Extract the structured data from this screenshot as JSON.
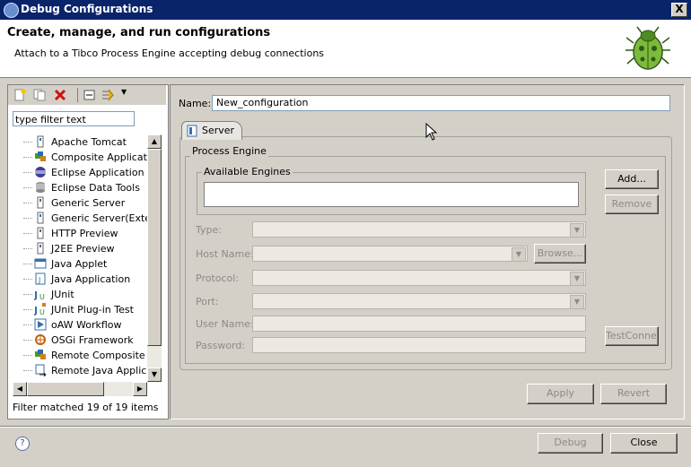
{
  "window": {
    "title": "Debug Configurations",
    "close_label": "X"
  },
  "header": {
    "title": "Create, manage, and run configurations",
    "subtitle": "Attach to a Tibco Process Engine accepting debug connections",
    "image": "bug-icon"
  },
  "left": {
    "toolbar": [
      "new-configuration-icon",
      "duplicate-icon",
      "delete-icon",
      "collapse-all-icon",
      "filter-icon",
      "dropdown-arrow-icon"
    ],
    "filter_placeholder": "type filter text",
    "items": [
      {
        "label": "Apache Tomcat",
        "icon": "server-icon"
      },
      {
        "label": "Composite Application",
        "icon": "composite-app-icon"
      },
      {
        "label": "Eclipse Application",
        "icon": "eclipse-icon"
      },
      {
        "label": "Eclipse Data Tools",
        "icon": "database-icon"
      },
      {
        "label": "Generic Server",
        "icon": "server-icon"
      },
      {
        "label": "Generic Server(Extern",
        "icon": "server-icon"
      },
      {
        "label": "HTTP Preview",
        "icon": "server-icon"
      },
      {
        "label": "J2EE Preview",
        "icon": "server-icon"
      },
      {
        "label": "Java Applet",
        "icon": "applet-icon"
      },
      {
        "label": "Java Application",
        "icon": "java-app-icon"
      },
      {
        "label": "JUnit",
        "icon": "junit-icon"
      },
      {
        "label": "JUnit Plug-in Test",
        "icon": "junit-plugin-icon"
      },
      {
        "label": "oAW Workflow",
        "icon": "workflow-icon"
      },
      {
        "label": "OSGi Framework",
        "icon": "osgi-icon"
      },
      {
        "label": "Remote Composite Ap",
        "icon": "composite-app-icon"
      },
      {
        "label": "Remote Java Applicati",
        "icon": "remote-java-icon"
      }
    ],
    "status": "Filter matched 19 of 19 items"
  },
  "config": {
    "name_label": "Name:",
    "name_value": "New_configuration",
    "tab_label": "Server",
    "group_label": "Process Engine",
    "engines_label": "Available Engines",
    "add_label": "Add...",
    "remove_label": "Remove",
    "test_label": "TestConnec",
    "browse_label": "Browse...",
    "type_label": "Type:",
    "host_label": "Host Name:",
    "protocol_label": "Protocol:",
    "port_label": "Port:",
    "user_label": "User Name:",
    "password_label": "Password:",
    "apply_label": "Apply",
    "revert_label": "Revert"
  },
  "footer": {
    "help": "?",
    "debug_label": "Debug",
    "close_label": "Close"
  },
  "colors": {
    "title_bar": "#0a246a",
    "dialog_bg": "#d4d0c8",
    "disabled_text": "#8c8a86"
  }
}
